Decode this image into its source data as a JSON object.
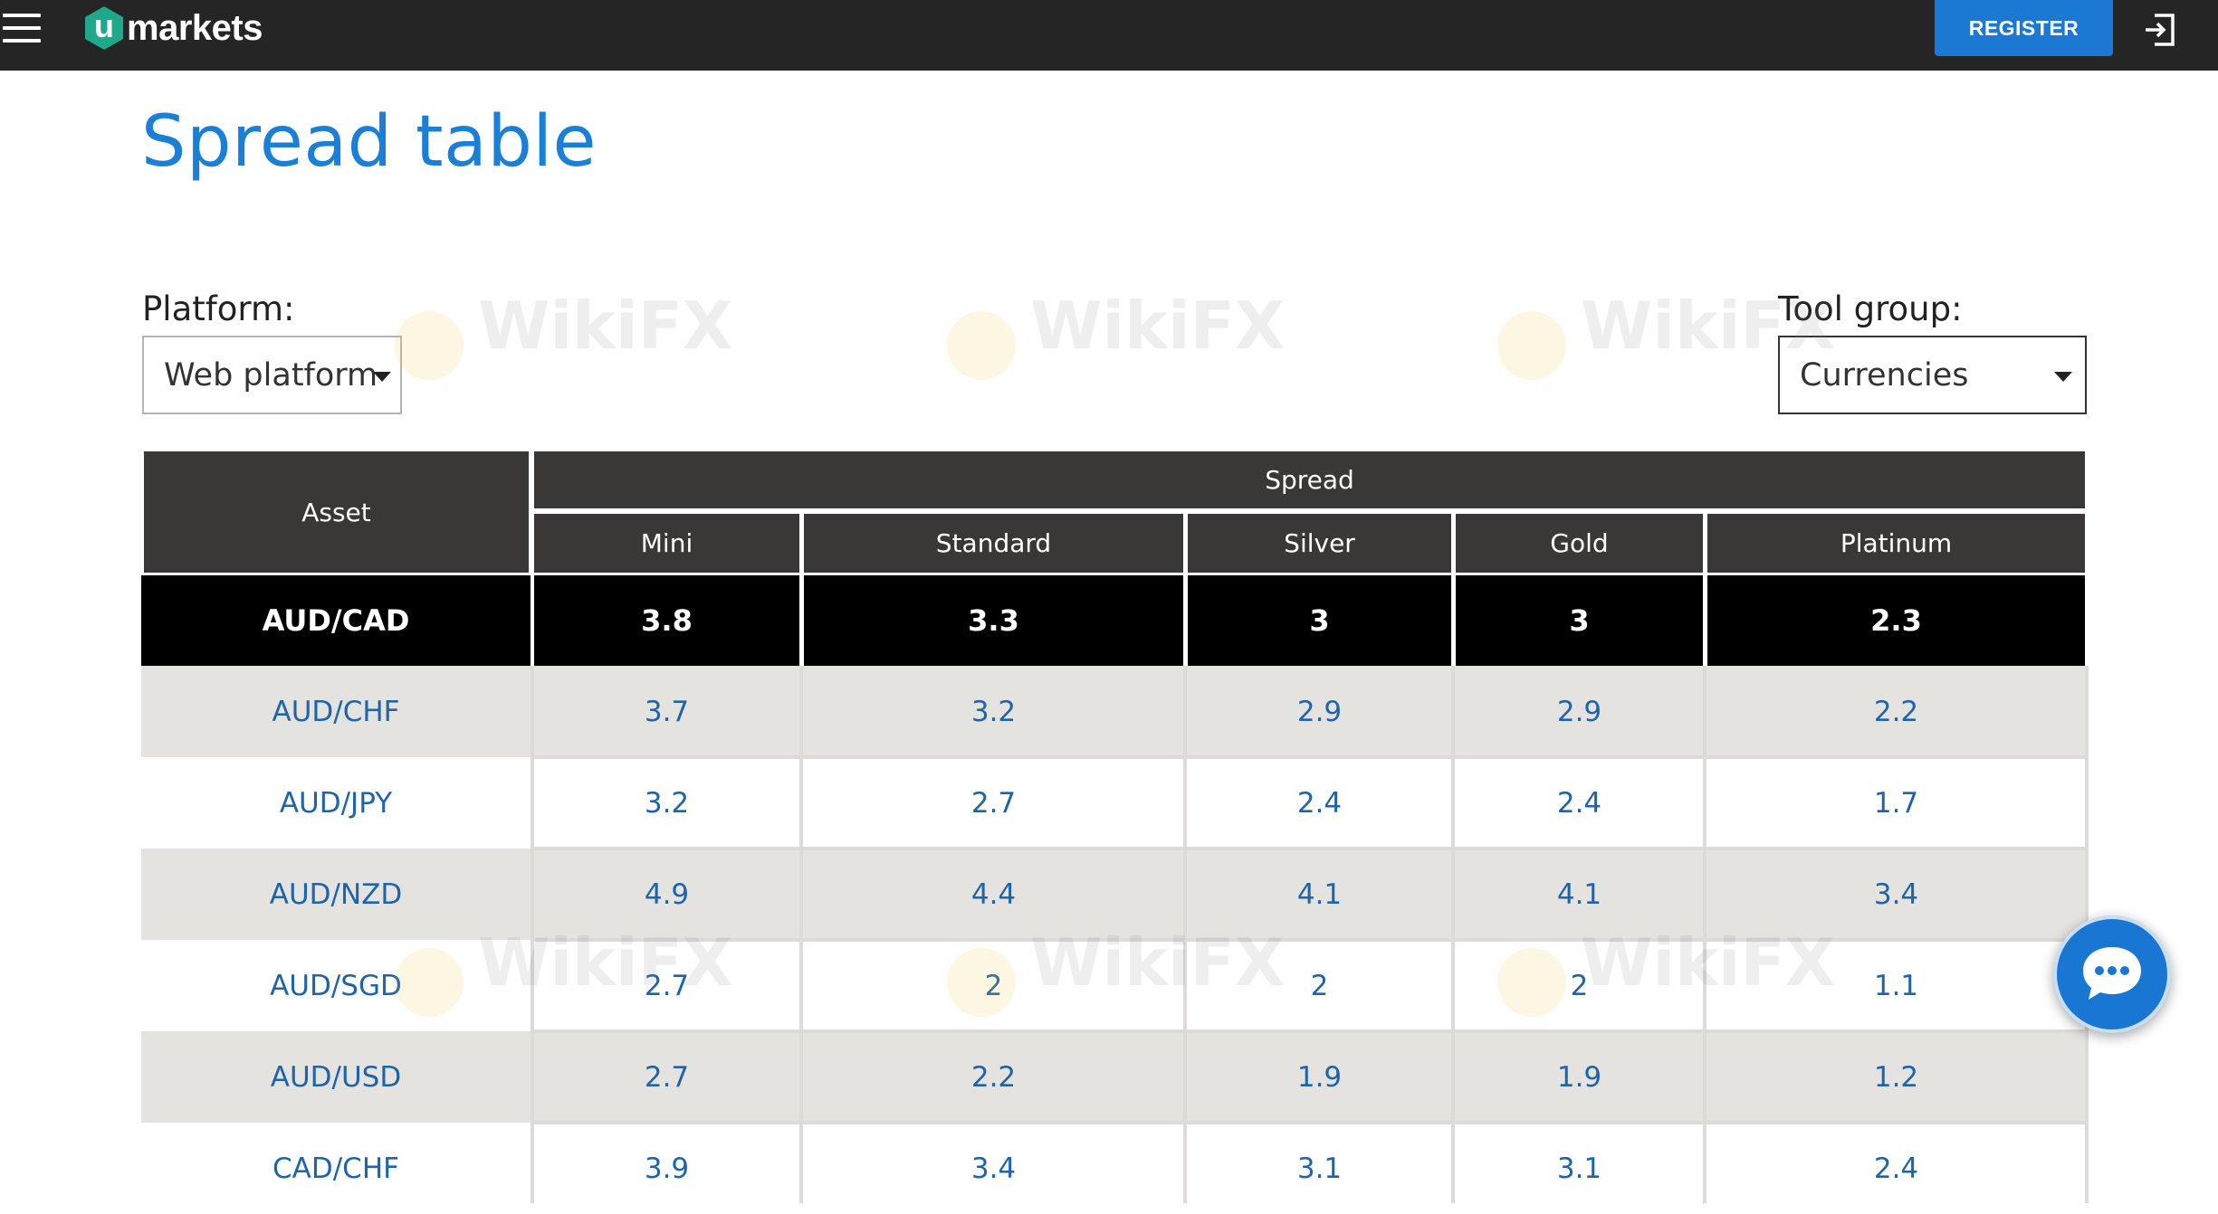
{
  "header": {
    "logo_mark": "u",
    "logo_text": "markets",
    "register_label": "REGISTER"
  },
  "page": {
    "title": "Spread table"
  },
  "filters": {
    "platform_label": "Platform:",
    "platform_value": "Web platform",
    "tool_group_label": "Tool group:",
    "tool_group_value": "Currencies"
  },
  "table": {
    "asset_header": "Asset",
    "spread_header": "Spread",
    "columns": [
      "Mini",
      "Standard",
      "Silver",
      "Gold",
      "Platinum"
    ],
    "rows": [
      {
        "asset": "AUD/CAD",
        "values": [
          "3.8",
          "3.3",
          "3",
          "3",
          "2.3"
        ],
        "highlighted": true
      },
      {
        "asset": "AUD/CHF",
        "values": [
          "3.7",
          "3.2",
          "2.9",
          "2.9",
          "2.2"
        ]
      },
      {
        "asset": "AUD/JPY",
        "values": [
          "3.2",
          "2.7",
          "2.4",
          "2.4",
          "1.7"
        ]
      },
      {
        "asset": "AUD/NZD",
        "values": [
          "4.9",
          "4.4",
          "4.1",
          "4.1",
          "3.4"
        ]
      },
      {
        "asset": "AUD/SGD",
        "values": [
          "2.7",
          "2",
          "2",
          "2",
          "1.1"
        ]
      },
      {
        "asset": "AUD/USD",
        "values": [
          "2.7",
          "2.2",
          "1.9",
          "1.9",
          "1.2"
        ]
      },
      {
        "asset": "CAD/CHF",
        "values": [
          "3.9",
          "3.4",
          "3.1",
          "3.1",
          "2.4"
        ]
      }
    ]
  },
  "watermark": {
    "text": "WikiFX"
  },
  "icons": {
    "menu": "hamburger-menu-icon",
    "login": "sign-in-icon",
    "chat": "chat-bubble-icon",
    "dropdown": "caret-down-icon"
  },
  "colors": {
    "brand_blue": "#1b78d3",
    "title_blue": "#1b7fd6",
    "header_dark": "#252525",
    "table_header": "#393836",
    "row_grey": "#e5e3e0",
    "logo_green": "#1fa88a"
  }
}
